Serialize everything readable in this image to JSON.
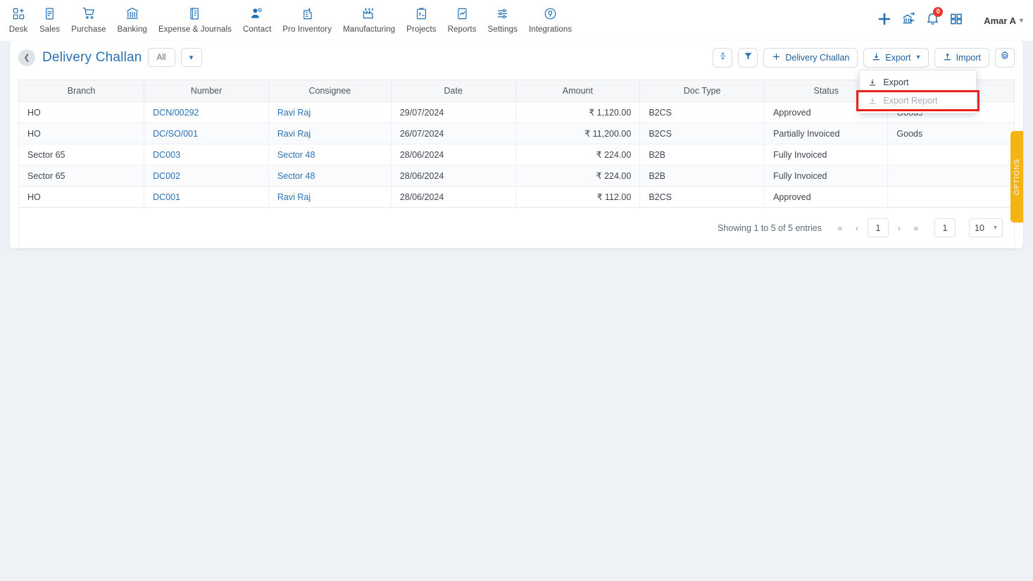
{
  "topnav": {
    "items": [
      {
        "label": "Desk",
        "icon": "desk-icon"
      },
      {
        "label": "Sales",
        "icon": "sales-icon"
      },
      {
        "label": "Purchase",
        "icon": "purchase-cart-icon"
      },
      {
        "label": "Banking",
        "icon": "bank-icon"
      },
      {
        "label": "Expense & Journals",
        "icon": "journal-icon"
      },
      {
        "label": "Contact",
        "icon": "contact-icon"
      },
      {
        "label": "Pro Inventory",
        "icon": "inventory-icon"
      },
      {
        "label": "Manufacturing",
        "icon": "manufacturing-icon"
      },
      {
        "label": "Projects",
        "icon": "projects-icon"
      },
      {
        "label": "Reports",
        "icon": "reports-icon"
      },
      {
        "label": "Settings",
        "icon": "settings-sliders-icon"
      },
      {
        "label": "Integrations",
        "icon": "integrations-icon"
      }
    ],
    "right": {
      "add_icon": "plus-icon",
      "bank_icon": "bank-transfer-icon",
      "notification_icon": "bell-icon",
      "notification_count": "0",
      "apps_icon": "grid-apps-icon",
      "user_name": "Amar A",
      "user_caret": "chevron-down-icon"
    }
  },
  "page": {
    "back_icon": "chevron-left-icon",
    "title": "Delivery Challan",
    "filter_pill": "All",
    "filter_caret": "chevron-down-icon",
    "actions": {
      "sort_icon": "sort-updown-icon",
      "filter_icon": "funnel-icon",
      "new_label": "Delivery Challan",
      "new_plus": "plus-icon",
      "export_label": "Export",
      "export_icon": "download-icon",
      "export_caret": "chevron-down-icon",
      "import_label": "Import",
      "import_icon": "upload-icon",
      "settings_icon": "gear-icon"
    },
    "export_menu": [
      {
        "label": "Export",
        "icon": "download-icon",
        "disabled": false,
        "highlighted": false
      },
      {
        "label": "Export Report",
        "icon": "download-icon",
        "disabled": true,
        "highlighted": true
      }
    ],
    "options_tab": "OPTIONS"
  },
  "table": {
    "columns": [
      "Branch",
      "Number",
      "Consignee",
      "Date",
      "Amount",
      "Doc Type",
      "Status",
      ""
    ],
    "rows": [
      {
        "branch": "HO",
        "number": "DCN/00292",
        "consignee": "Ravi Raj",
        "date": "29/07/2024",
        "amount": "₹ 1,120.00",
        "doc_type": "B2CS",
        "status": "Approved",
        "extra": "Goods"
      },
      {
        "branch": "HO",
        "number": "DC/SO/001",
        "consignee": "Ravi Raj",
        "date": "26/07/2024",
        "amount": "₹ 11,200.00",
        "doc_type": "B2CS",
        "status": "Partially Invoiced",
        "extra": "Goods"
      },
      {
        "branch": "Sector 65",
        "number": "DC003",
        "consignee": "Sector 48",
        "date": "28/06/2024",
        "amount": "₹ 224.00",
        "doc_type": "B2B",
        "status": "Fully Invoiced",
        "extra": ""
      },
      {
        "branch": "Sector 65",
        "number": "DC002",
        "consignee": "Sector 48",
        "date": "28/06/2024",
        "amount": "₹ 224.00",
        "doc_type": "B2B",
        "status": "Fully Invoiced",
        "extra": ""
      },
      {
        "branch": "HO",
        "number": "DC001",
        "consignee": "Ravi Raj",
        "date": "28/06/2024",
        "amount": "₹ 112.00",
        "doc_type": "B2CS",
        "status": "Approved",
        "extra": ""
      }
    ]
  },
  "pagination": {
    "info": "Showing 1 to 5 of 5 entries",
    "first_icon": "double-chevron-left-icon",
    "prev_icon": "chevron-left-icon",
    "current_page": "1",
    "next_icon": "chevron-right-icon",
    "last_icon": "double-chevron-right-icon",
    "jump_value": "1",
    "page_size": "10",
    "page_size_caret": "chevron-down-icon"
  },
  "colors": {
    "accent": "#2a72b5",
    "page_bg": "#eef1f5",
    "highlight": "#e8231f",
    "options_tab": "#f5b316",
    "badge": "#e8392e"
  }
}
